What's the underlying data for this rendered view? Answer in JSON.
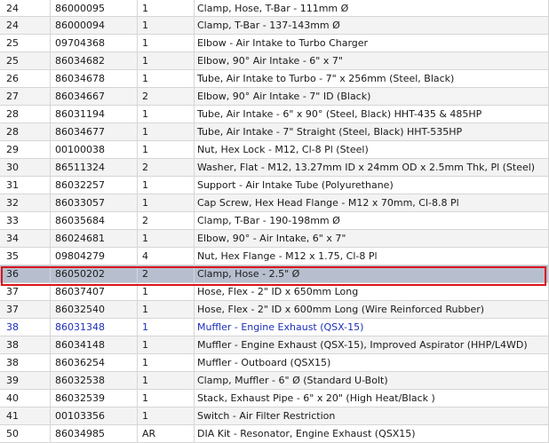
{
  "highlight_color": "#d9141b",
  "selected_row_bg": "#b7bfcf",
  "link_color": "#1b2fb8",
  "rows": [
    {
      "ref": "24",
      "part": "86000095",
      "qty": "1",
      "desc": "Clamp, Hose, T-Bar - 111mm Ø"
    },
    {
      "ref": "24",
      "part": "86000094",
      "qty": "1",
      "desc": "Clamp, T-Bar - 137-143mm Ø"
    },
    {
      "ref": "25",
      "part": "09704368",
      "qty": "1",
      "desc": "Elbow - Air Intake to Turbo Charger"
    },
    {
      "ref": "25",
      "part": "86034682",
      "qty": "1",
      "desc": "Elbow, 90° Air Intake - 6\" x 7\""
    },
    {
      "ref": "26",
      "part": "86034678",
      "qty": "1",
      "desc": "Tube, Air Intake to Turbo - 7\" x 256mm (Steel, Black)"
    },
    {
      "ref": "27",
      "part": "86034667",
      "qty": "2",
      "desc": "Elbow, 90° Air Intake - 7\" ID (Black)"
    },
    {
      "ref": "28",
      "part": "86031194",
      "qty": "1",
      "desc": "Tube, Air Intake - 6\" x 90° (Steel, Black) HHT-435 & 485HP"
    },
    {
      "ref": "28",
      "part": "86034677",
      "qty": "1",
      "desc": "Tube, Air Intake - 7\" Straight (Steel, Black) HHT-535HP"
    },
    {
      "ref": "29",
      "part": "00100038",
      "qty": "1",
      "desc": "Nut, Hex Lock - M12, Cl-8 Pl (Steel)"
    },
    {
      "ref": "30",
      "part": "86511324",
      "qty": "2",
      "desc": "Washer, Flat - M12, 13.27mm ID x 24mm OD x 2.5mm Thk, Pl (Steel)"
    },
    {
      "ref": "31",
      "part": "86032257",
      "qty": "1",
      "desc": "Support - Air Intake Tube (Polyurethane)"
    },
    {
      "ref": "32",
      "part": "86033057",
      "qty": "1",
      "desc": "Cap Screw, Hex Head Flange - M12 x 70mm, Cl-8.8 Pl"
    },
    {
      "ref": "33",
      "part": "86035684",
      "qty": "2",
      "desc": "Clamp, T-Bar - 190-198mm Ø"
    },
    {
      "ref": "34",
      "part": "86024681",
      "qty": "1",
      "desc": "Elbow, 90° - Air Intake, 6\" x 7\""
    },
    {
      "ref": "35",
      "part": "09804279",
      "qty": "4",
      "desc": "Nut, Hex Flange - M12 x 1.75, Cl-8 Pl"
    },
    {
      "ref": "36",
      "part": "86050202",
      "qty": "2",
      "desc": "Clamp, Hose - 2.5\" Ø",
      "selected": true
    },
    {
      "ref": "37",
      "part": "86037407",
      "qty": "1",
      "desc": "Hose, Flex - 2\" ID x 650mm Long"
    },
    {
      "ref": "37",
      "part": "86032540",
      "qty": "1",
      "desc": "Hose, Flex - 2\" ID x 600mm Long (Wire Reinforced Rubber)"
    },
    {
      "ref": "38",
      "part": "86031348",
      "qty": "1",
      "desc": "Muffler - Engine Exhaust (QSX-15)",
      "link": true
    },
    {
      "ref": "38",
      "part": "86034148",
      "qty": "1",
      "desc": "Muffler - Engine Exhaust (QSX-15), Improved Aspirator (HHP/L4WD)"
    },
    {
      "ref": "38",
      "part": "86036254",
      "qty": "1",
      "desc": "Muffler - Outboard (QSX15)"
    },
    {
      "ref": "39",
      "part": "86032538",
      "qty": "1",
      "desc": "Clamp, Muffler - 6\" Ø (Standard U-Bolt)"
    },
    {
      "ref": "40",
      "part": "86032539",
      "qty": "1",
      "desc": "Stack, Exhaust Pipe - 6\" x 20\" (High Heat/Black )"
    },
    {
      "ref": "41",
      "part": "00103356",
      "qty": "1",
      "desc": "Switch - Air Filter Restriction"
    },
    {
      "ref": "50",
      "part": "86034985",
      "qty": "AR",
      "desc": "DIA Kit - Resonator, Engine Exhaust (QSX15)"
    }
  ]
}
